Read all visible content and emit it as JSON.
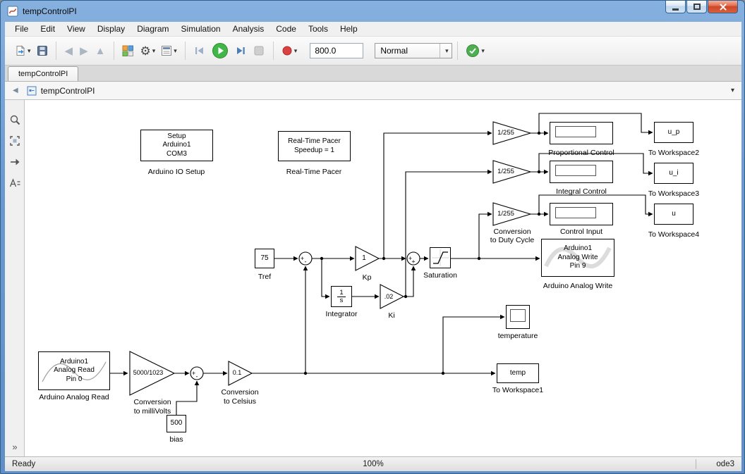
{
  "window": {
    "title": "tempControlPI"
  },
  "menu": {
    "items": [
      "File",
      "Edit",
      "View",
      "Display",
      "Diagram",
      "Simulation",
      "Analysis",
      "Code",
      "Tools",
      "Help"
    ]
  },
  "toolbar": {
    "sim_time": "800.0",
    "mode": "Normal"
  },
  "tab": {
    "label": "tempControlPI"
  },
  "breadcrumb": {
    "model": "tempControlPI"
  },
  "status": {
    "ready": "Ready",
    "zoom": "100%",
    "solver": "ode3"
  },
  "icons": {
    "caret": "▾",
    "gear": "⚙",
    "back": "◀",
    "forward": "▶",
    "up": "▲",
    "chevrons": "»"
  },
  "diagram": {
    "arduino_setup": {
      "l1": "Setup",
      "l2": "Arduino1",
      "l3": "COM3",
      "label": "Arduino IO Setup"
    },
    "rt_pacer": {
      "l1": "Real-Time Pacer",
      "l2": "Speedup = 1",
      "label": "Real-Time Pacer"
    },
    "gain1": {
      "value": "1/255"
    },
    "gain2": {
      "value": "1/255"
    },
    "gain3": {
      "value": "1/255",
      "label1": "Conversion",
      "label2": "to Duty Cycle"
    },
    "display1": {
      "label": "Proportional Control"
    },
    "display2": {
      "label": "Integral Control"
    },
    "display3": {
      "label": "Control Input"
    },
    "ws_up": {
      "value": "u_p",
      "label": "To Workspace2"
    },
    "ws_ui": {
      "value": "u_i",
      "label": "To Workspace3"
    },
    "ws_u": {
      "value": "u",
      "label": "To Workspace4"
    },
    "analog_write": {
      "l1": "Arduino1",
      "l2": "Analog Write",
      "l3": "Pin 9",
      "label": "Arduino Analog Write"
    },
    "tref": {
      "value": "75",
      "label": "Tref"
    },
    "kp": {
      "value": "1",
      "label": "Kp"
    },
    "ki": {
      "value": ".02",
      "label": "Ki"
    },
    "integrator": {
      "num": "1",
      "den": "s",
      "label": "Integrator"
    },
    "saturation": {
      "label": "Saturation"
    },
    "scope": {
      "label": "temperature"
    },
    "ws_temp": {
      "value": "temp",
      "label": "To Workspace1"
    },
    "analog_read": {
      "l1": "Arduino1",
      "l2": "Analog Read",
      "l3": "Pin 0",
      "label": "Arduino Analog Read"
    },
    "gain_mv": {
      "value": "5000/1023",
      "label1": "Conversion",
      "label2": "to milliVolts"
    },
    "gain_c": {
      "value": "0.1",
      "label1": "Conversion",
      "label2": "to Celsius"
    },
    "bias": {
      "value": "500",
      "label": "bias"
    },
    "sum1": {
      "left": "+",
      "bottom": "-"
    },
    "sum2": {
      "left": "+",
      "bottom": "+"
    },
    "sum3": {
      "left": "+",
      "bottom": "-"
    }
  }
}
